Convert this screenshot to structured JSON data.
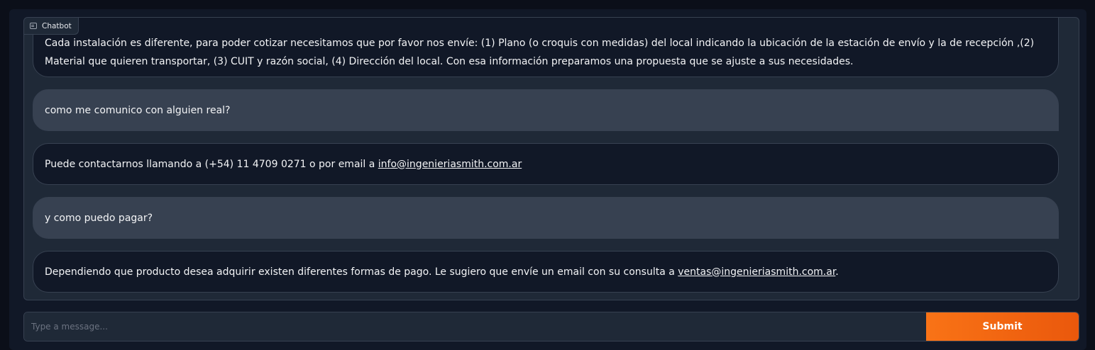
{
  "chatbot": {
    "label": "Chatbot",
    "icon": "chat-icon"
  },
  "messages": [
    {
      "role": "bot",
      "text": "Cada instalación es diferente, para poder cotizar necesitamos que por favor nos envíe: (1) Plano (o croquis con medidas) del local indicando la ubicación de la estación de envío y la de recepción ,(2) Material que quieren transportar, (3) CUIT y razón social, (4) Dirección del local. Con esa información preparamos una propuesta que se ajuste a sus necesidades."
    },
    {
      "role": "user",
      "text": "como me comunico con alguien real?"
    },
    {
      "role": "bot",
      "text_before": "Puede contactarnos llamando a (+54) 11 4709 0271 o por email a ",
      "link": "info@ingenieriasmith.com.ar",
      "text_after": ""
    },
    {
      "role": "user",
      "text": "y como puedo pagar?"
    },
    {
      "role": "bot",
      "text_before": "Dependiendo que producto desea adquirir existen diferentes formas de pago. Le sugiero que envíe un email con su consulta a ",
      "link": "ventas@ingenieriasmith.com.ar",
      "text_after": "."
    }
  ],
  "input": {
    "placeholder": "Type a message...",
    "value": ""
  },
  "submit": {
    "label": "Submit"
  },
  "colors": {
    "background": "#0b0f19",
    "panel": "#1f2937",
    "user_bubble": "#374151",
    "bot_bubble": "#111827",
    "accent": "#f97316"
  }
}
